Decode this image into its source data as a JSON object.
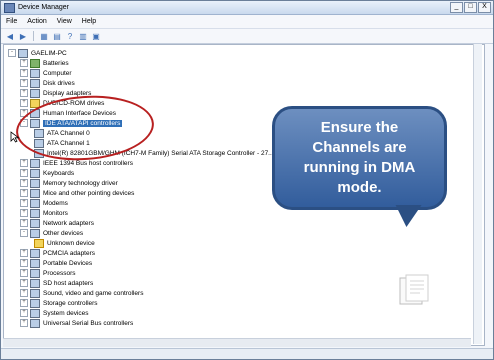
{
  "window": {
    "title": "Device Manager",
    "buttons": [
      "_",
      "□",
      "X"
    ]
  },
  "menubar": {
    "items": [
      "File",
      "Action",
      "View",
      "Help"
    ]
  },
  "toolbar": {
    "buttons": [
      "back-icon",
      "forward-icon",
      "properties-icon",
      "refresh-icon",
      "help-icon",
      "scan-icon",
      "monitor-icon"
    ]
  },
  "tree": {
    "root": "GAELIM-PC",
    "items": [
      {
        "label": "Batteries"
      },
      {
        "label": "Computer"
      },
      {
        "label": "Disk drives"
      },
      {
        "label": "Display adapters"
      },
      {
        "label": "DVD/CD-ROM drives"
      },
      {
        "label": "Human Interface Devices"
      },
      {
        "label": "IDE ATA/ATAPI controllers",
        "selected": true,
        "children": [
          {
            "label": "ATA Channel 0"
          },
          {
            "label": "ATA Channel 1"
          },
          {
            "label": "Intel(R) 82801GBM/GHM (ICH7-M Family) Serial ATA Storage Controller - 27..."
          }
        ]
      },
      {
        "label": "IEEE 1394 Bus host controllers"
      },
      {
        "label": "Keyboards"
      },
      {
        "label": "Memory technology driver"
      },
      {
        "label": "Mice and other pointing devices"
      },
      {
        "label": "Modems"
      },
      {
        "label": "Monitors"
      },
      {
        "label": "Network adapters"
      },
      {
        "label": "Other devices",
        "children": [
          {
            "label": "Unknown device"
          }
        ]
      },
      {
        "label": "PCMCIA adapters"
      },
      {
        "label": "Portable Devices"
      },
      {
        "label": "Processors"
      },
      {
        "label": "SD host adapters"
      },
      {
        "label": "Sound, video and game controllers"
      },
      {
        "label": "Storage controllers"
      },
      {
        "label": "System devices"
      },
      {
        "label": "Universal Serial Bus controllers"
      }
    ]
  },
  "callout": {
    "text": "Ensure the Channels are running in DMA mode."
  }
}
